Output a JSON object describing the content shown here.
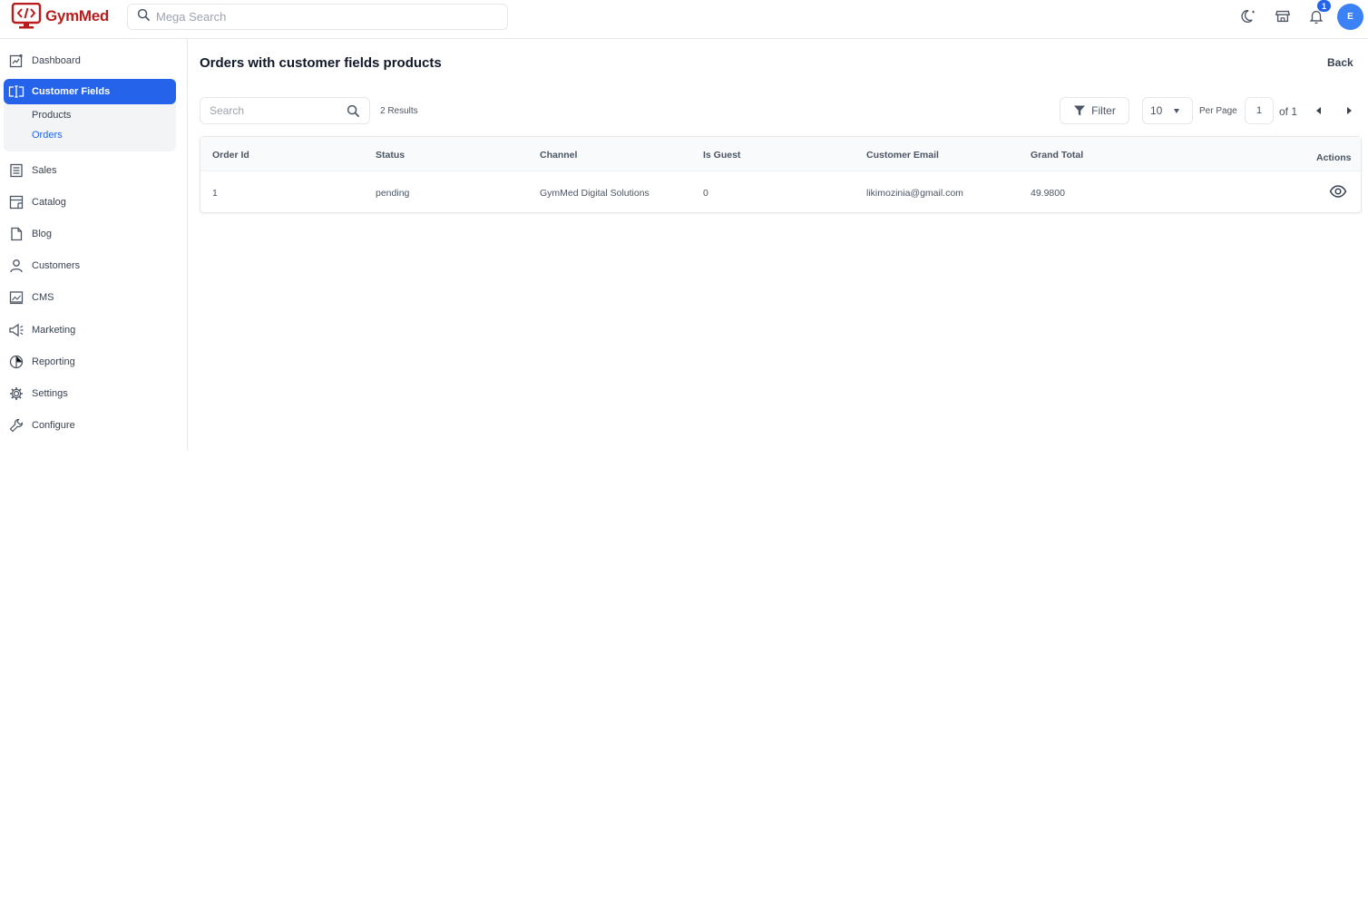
{
  "brand": {
    "name": "GymMed",
    "color": "#b91c1c"
  },
  "header": {
    "search_placeholder": "Mega Search",
    "notification_count": "1",
    "avatar_initial": "E",
    "icons": [
      "dark-mode-icon",
      "storefront-icon",
      "bell-icon"
    ]
  },
  "sidebar": {
    "items": [
      {
        "label": "Dashboard",
        "icon": "dashboard-icon"
      },
      {
        "label": "Customer Fields",
        "icon": "customer-fields-icon",
        "active": true
      },
      {
        "label": "Sales",
        "icon": "sales-icon"
      },
      {
        "label": "Catalog",
        "icon": "catalog-icon"
      },
      {
        "label": "Blog",
        "icon": "blog-icon"
      },
      {
        "label": "Customers",
        "icon": "customers-icon"
      },
      {
        "label": "CMS",
        "icon": "cms-icon"
      },
      {
        "label": "Marketing",
        "icon": "marketing-icon"
      },
      {
        "label": "Reporting",
        "icon": "reporting-icon"
      },
      {
        "label": "Settings",
        "icon": "settings-icon"
      },
      {
        "label": "Configure",
        "icon": "configure-icon"
      }
    ],
    "subitems": [
      {
        "label": "Products"
      },
      {
        "label": "Orders",
        "selected": true
      }
    ],
    "accent": "#2563eb"
  },
  "main": {
    "title": "Orders with customer fields products",
    "back_label": "Back",
    "search_placeholder": "Search",
    "results_text": "2 Results",
    "filter_label": "Filter",
    "per_page_value": "10",
    "per_page_label": "Per Page",
    "page_value": "1",
    "page_of": "of 1"
  },
  "table": {
    "columns": [
      "Order Id",
      "Status",
      "Channel",
      "Is Guest",
      "Customer Email",
      "Grand Total",
      "Actions"
    ],
    "rows": [
      [
        "1",
        "pending",
        "GymMed Digital Solutions",
        "0",
        "likimozinia@gmail.com",
        "49.9800"
      ]
    ]
  }
}
